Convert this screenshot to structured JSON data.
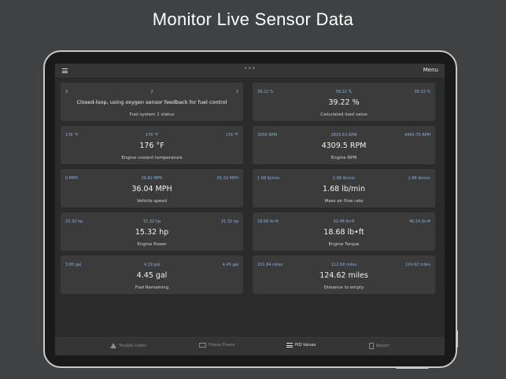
{
  "headline": "Monitor Live Sensor Data",
  "topbar": {
    "grabber": "•••",
    "menu_label": "Menu"
  },
  "cards": [
    {
      "min": "2",
      "current": "2",
      "max": "2",
      "value": "Closed-loop, using oxygen sensor feedback for fuel control",
      "label": "Fuel system 1 status"
    },
    {
      "min": "39.22 %",
      "current": "39.22 %",
      "max": "39.22 %",
      "value": "39.22 %",
      "label": "Calculated load value"
    },
    {
      "min": "176 °F",
      "current": "176 °F",
      "max": "176 °F",
      "value": "176 °F",
      "label": "Engine coolant temperature"
    },
    {
      "min": "2000 RPM",
      "current": "2833.63 RPM",
      "max": "4999.75 RPM",
      "value": "4309.5 RPM",
      "label": "Engine RPM"
    },
    {
      "min": "0 MPH",
      "current": "29.62 MPH",
      "max": "61.52 MPH",
      "value": "36.04 MPH",
      "label": "Vehicle speed"
    },
    {
      "min": "1.68 lb/min",
      "current": "1.68 lb/min",
      "max": "1.68 lb/min",
      "value": "1.68 lb/min",
      "label": "Mass air flow rate"
    },
    {
      "min": "15.32 hp",
      "current": "15.32 hp",
      "max": "15.32 hp",
      "value": "15.32 hp",
      "label": "Engine Power"
    },
    {
      "min": "18.68 lb•ft",
      "current": "32.48 lb•ft",
      "max": "40.24 lb•ft",
      "value": "18.68 lb•ft",
      "label": "Engine Torque"
    },
    {
      "min": "3.95 gal",
      "current": "4.19 gal",
      "max": "4.45 gal",
      "value": "4.45 gal",
      "label": "Fuel Remaining"
    },
    {
      "min": "101.84 miles",
      "current": "112.68 miles",
      "max": "124.62 miles",
      "value": "124.62 miles",
      "label": "Distance to empty"
    }
  ],
  "tabs": [
    {
      "label": "Trouble Codes"
    },
    {
      "label": "Freeze Frame"
    },
    {
      "label": "PID Values"
    },
    {
      "label": "Report"
    }
  ],
  "colors": {
    "accent": "#8ab0d8",
    "card": "#3b3b3b",
    "screen": "#2b2b2b",
    "background": "#3f4142"
  }
}
